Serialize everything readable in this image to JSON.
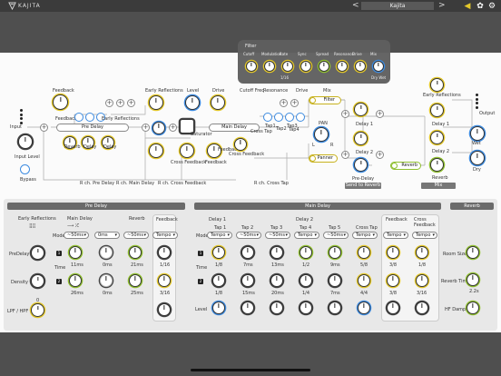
{
  "topbar": {
    "brand": "KAJITA",
    "preset_name": "Kajita",
    "prev": "<",
    "next": ">",
    "icons": [
      "mute-icon",
      "palette-icon",
      "settings-icon"
    ]
  },
  "popup": {
    "title": "Filter",
    "params": [
      {
        "label": "Cutoff",
        "value": "",
        "color": "#e3c72a"
      },
      {
        "label": "Modulation",
        "value": "",
        "color": "#e3c72a"
      },
      {
        "label": "Rate",
        "value": "1/16",
        "color": "#e3c72a"
      },
      {
        "label": "Sync",
        "value": "",
        "color": "#e3c72a"
      },
      {
        "label": "Spread",
        "value": "",
        "color": "#8fbf2f"
      },
      {
        "label": "Resonance",
        "value": "",
        "color": "#e3c72a"
      },
      {
        "label": "Drive",
        "value": "",
        "color": "#e3c72a"
      },
      {
        "label": "Mix",
        "value": "Dry   Wet",
        "color": "#3d8be0"
      }
    ]
  },
  "graph": {
    "input": "Input",
    "input_level": "Input Level",
    "bypass": "Bypass",
    "feedback": "Feedback",
    "feedback2": "Feedback",
    "early_reflections": "Early Reflections",
    "early_reflections2": "Early Reflections",
    "pre_delay": "Pre Delay",
    "reverb": "Reverb",
    "delay": "Delay",
    "delay2": "Delay",
    "level": "Level",
    "drive": "Drive",
    "saturator": "Saturator",
    "main_delay": "Main Delay",
    "cross_feedback": "Cross Feedback",
    "feedback3": "Feedback",
    "feedback4": "Feedback",
    "cross_feedback2": "Cross Feedback",
    "cross_tap": "Cross Tap",
    "tap1": "Tap1",
    "tap2": "Tap2",
    "tap3": "Tap3",
    "tap4": "Tap4",
    "cutoff_freq": "Cutoff Freq",
    "resonance": "Resonance",
    "drive2": "Drive",
    "mix": "Mix",
    "filter": "Filter",
    "pan": "PAN",
    "panner": "Panner",
    "pan_l": "L",
    "pan_r": "R",
    "delay1": "Delay 1",
    "delay2b": "Delay 2",
    "early_reflections3": "Early Reflections",
    "delay1b": "Delay 1",
    "delay2c": "Delay 2",
    "reverb2": "Reverb",
    "reverb3": "Reverb",
    "pre_delay2": "Pre-Delay",
    "send_to_reverb": "Send to Reverb",
    "mix2": "Mix",
    "output": "Output",
    "wet": "Wet",
    "dry": "Dry",
    "rch_pre_delay": "R ch. Pre Delay",
    "rch_main_delay": "R ch. Main Delay",
    "rch_cross_feedback": "R ch. Cross Feedback",
    "rch_cross_tap": "R ch. Cross Tap"
  },
  "predelay": {
    "title": "Pre Delay",
    "col_er": "Early Reflections",
    "col_main": "Main Delay",
    "col_rev": "Reverb",
    "col_fb": "Feedback",
    "mode": "Mode",
    "mode_vals": [
      "~50ms",
      "0ms",
      "~50ms",
      "Tempo"
    ],
    "predelay": "PreDelay",
    "time": "Time",
    "density": "Density",
    "lpf_hpf": "LPF / HPF",
    "time_vals": [
      "11ms",
      "0ms",
      "21ms"
    ],
    "time_vals2": [
      "26ms",
      "0ms",
      "25ms"
    ],
    "fb_vals": [
      "1/16",
      "3/16"
    ],
    "marker": "0",
    "btn1": "1",
    "btn2": "2"
  },
  "maindelay": {
    "title": "Main Delay",
    "delay1": "Delay 1",
    "delay2": "Delay 2",
    "tap_headers": [
      "Tap 1",
      "Tap 2",
      "Tap 3",
      "Tap 4",
      "Tap 5",
      "Cross Tap"
    ],
    "feedback": "Feedback",
    "cross_feedback": "Cross Feedback",
    "mode": "Mode",
    "mode_vals": [
      "Tempo",
      "~50ms",
      "~50ms",
      "Tempo",
      "~50ms",
      "Tempo",
      "Tempo",
      "Tempo"
    ],
    "time": "Time",
    "level": "Level",
    "row1": [
      "1/8",
      "7ms",
      "13ms",
      "1/2",
      "9ms",
      "5/8",
      "3/8",
      "1/8"
    ],
    "row2": [
      "1/8",
      "15ms",
      "20ms",
      "1/4",
      "7ms",
      "4/4",
      "3/8",
      "3/16"
    ],
    "btn1": "1",
    "btn2": "2"
  },
  "reverb": {
    "title": "Reverb",
    "room_size": "Room Size",
    "reverb_time": "Reverb Time",
    "reverb_time_val": "2.2s",
    "hf_damp": "HF Damp"
  }
}
